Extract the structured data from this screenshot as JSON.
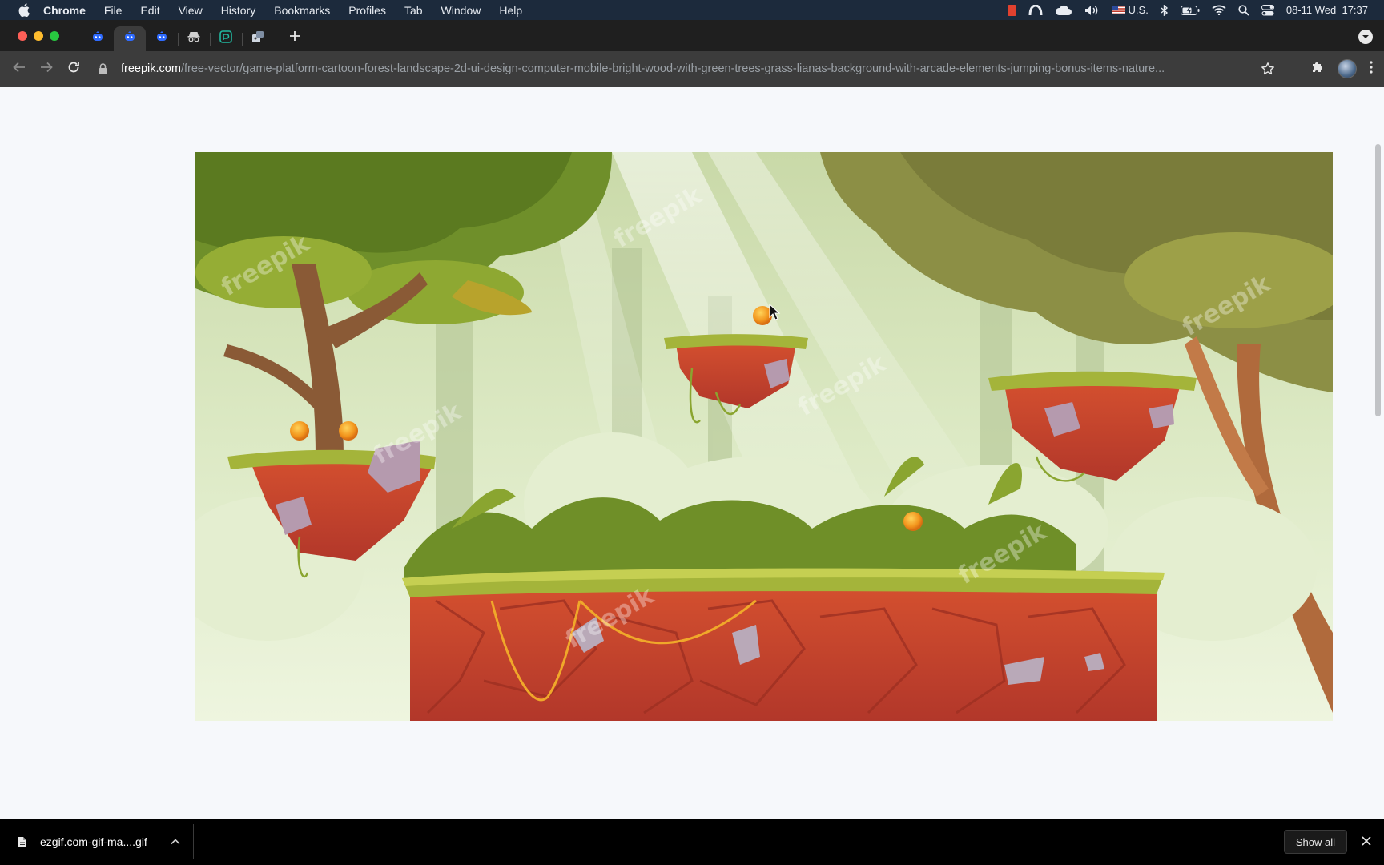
{
  "menubar": {
    "app_name": "Chrome",
    "items": [
      "File",
      "Edit",
      "View",
      "History",
      "Bookmarks",
      "Profiles",
      "Tab",
      "Window",
      "Help"
    ],
    "input_source": "U.S.",
    "clock": "08-11 Wed  17:37"
  },
  "tabs": [
    {
      "icon": "bot-icon",
      "active": false
    },
    {
      "icon": "bot-icon",
      "active": true
    },
    {
      "icon": "bot-icon",
      "active": false
    },
    {
      "icon": "incognito-icon",
      "active": false
    },
    {
      "icon": "perplexity-icon",
      "active": false
    },
    {
      "icon": "extension-tab-icon",
      "active": false
    }
  ],
  "address_bar": {
    "host": "freepik.com",
    "path": "/free-vector/game-platform-cartoon-forest-landscape-2d-ui-design-computer-mobile-bright-wood-with-green-trees-grass-lianas-background-with-arcade-elements-jumping-bonus-items-nature..."
  },
  "preview_image": {
    "watermark": "freepik"
  },
  "downloads": {
    "file_name": "ezgif.com-gif-ma....gif",
    "show_all_label": "Show all"
  },
  "colors": {
    "menubar_bg": "#1c2a3c",
    "toolbar_bg": "#3c3c3c",
    "page_bg": "#f6f8fb",
    "tab_icon_blue": "#2f6bff",
    "platform_red": "#c8412d",
    "grass_green": "#a4b43a"
  }
}
